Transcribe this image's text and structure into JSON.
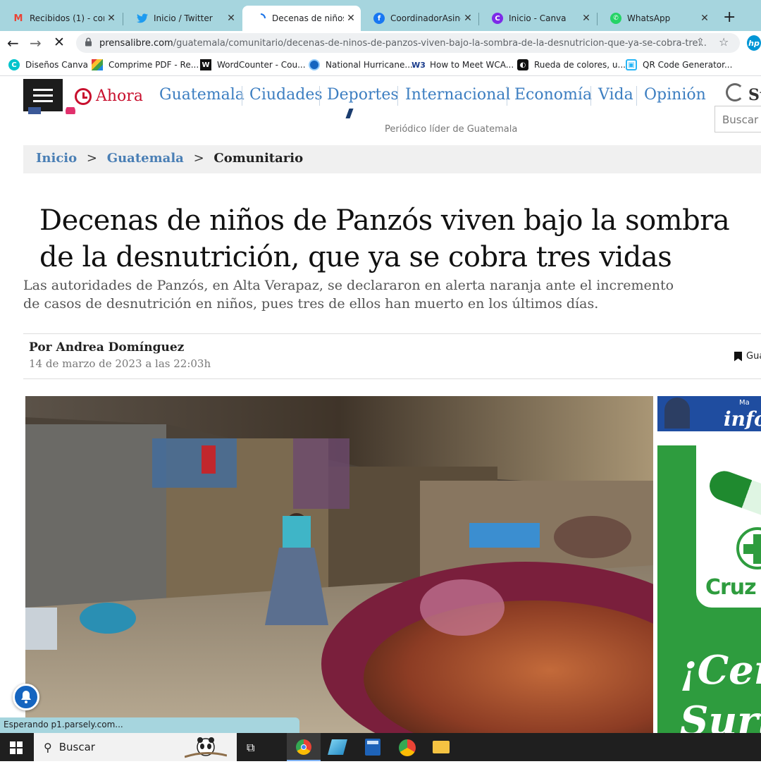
{
  "tabs": [
    {
      "title": "Recibidos (1) - com",
      "icon": "gmail-icon",
      "letter": "M",
      "color": "#ea4335"
    },
    {
      "title": "Inicio / Twitter",
      "icon": "twitter-icon",
      "letter": "t",
      "color": "#1d9bf0"
    },
    {
      "title": "Decenas de niños d",
      "icon": "loading-icon",
      "letter": "",
      "color": "#1a73e8"
    },
    {
      "title": "CoordinadorAsinde",
      "icon": "facebook-icon",
      "letter": "f",
      "color": "#1877f2"
    },
    {
      "title": "Inicio - Canva",
      "icon": "canva-icon",
      "letter": "C",
      "color": "#7d2ae8"
    },
    {
      "title": "WhatsApp",
      "icon": "whatsapp-icon",
      "letter": "✆",
      "color": "#25d366"
    }
  ],
  "url": {
    "host": "prensalibre.com",
    "path": "/guatemala/comunitario/decenas-de-ninos-de-panzos-viven-bajo-la-sombra-de-la-desnutricion-que-ya-se-cobra-tre..."
  },
  "bookmarks": [
    {
      "label": "Diseños Canva",
      "icon": "canva-icon"
    },
    {
      "label": "Comprime PDF - Re...",
      "icon": "pdf-icon"
    },
    {
      "label": "WordCounter - Cou...",
      "icon": "wordcounter-icon"
    },
    {
      "label": "National Hurricane...",
      "icon": "noaa-icon"
    },
    {
      "label": "How to Meet WCA...",
      "icon": "w3-icon"
    },
    {
      "label": "Rueda de colores, u...",
      "icon": "color-wheel-icon"
    },
    {
      "label": "QR Code Generator...",
      "icon": "qr-icon"
    }
  ],
  "site": {
    "ahora": "Ahora",
    "nav": [
      "Guatemala",
      "Ciudades",
      "Deportes",
      "Internacional",
      "Economía",
      "Vida",
      "Opinión"
    ],
    "tagline": "Periódico líder de Guatemala",
    "search_placeholder": "Buscar",
    "partial_right": "St"
  },
  "breadcrumb": {
    "home": "Inicio",
    "section": "Guatemala",
    "current": "Comunitario",
    "sep": ">"
  },
  "article": {
    "headline": "Decenas de niños de Panzós viven bajo la sombra de la desnutrición, que ya se cobra tres vidas",
    "dek": "Las autoridades de Panzós, en Alta Verapaz, se declararon en alerta naranja ante el incremento de casos de desnutrición en niños, pues tres de ellos han muerto en los últimos días.",
    "author": "Por Andrea Domínguez",
    "date": "14 de marzo de 2023 a las 22:03h",
    "save_label": "Gua"
  },
  "ads": {
    "top_partial_line1": "Ma",
    "top_partial_line2": "info",
    "brand": "Cruz V",
    "slogan1": "¡Cer",
    "slogan2": "Surt"
  },
  "status_text": "Esperando p1.parsely.com...",
  "taskbar": {
    "search": "Buscar"
  },
  "colors": {
    "tabstrip": "#a6d5de",
    "nav_link": "#3c7ec1",
    "breadcrumb_link": "#4a7fb5",
    "ahora_red": "#c8102e",
    "ad_green": "#2e9c3e"
  }
}
